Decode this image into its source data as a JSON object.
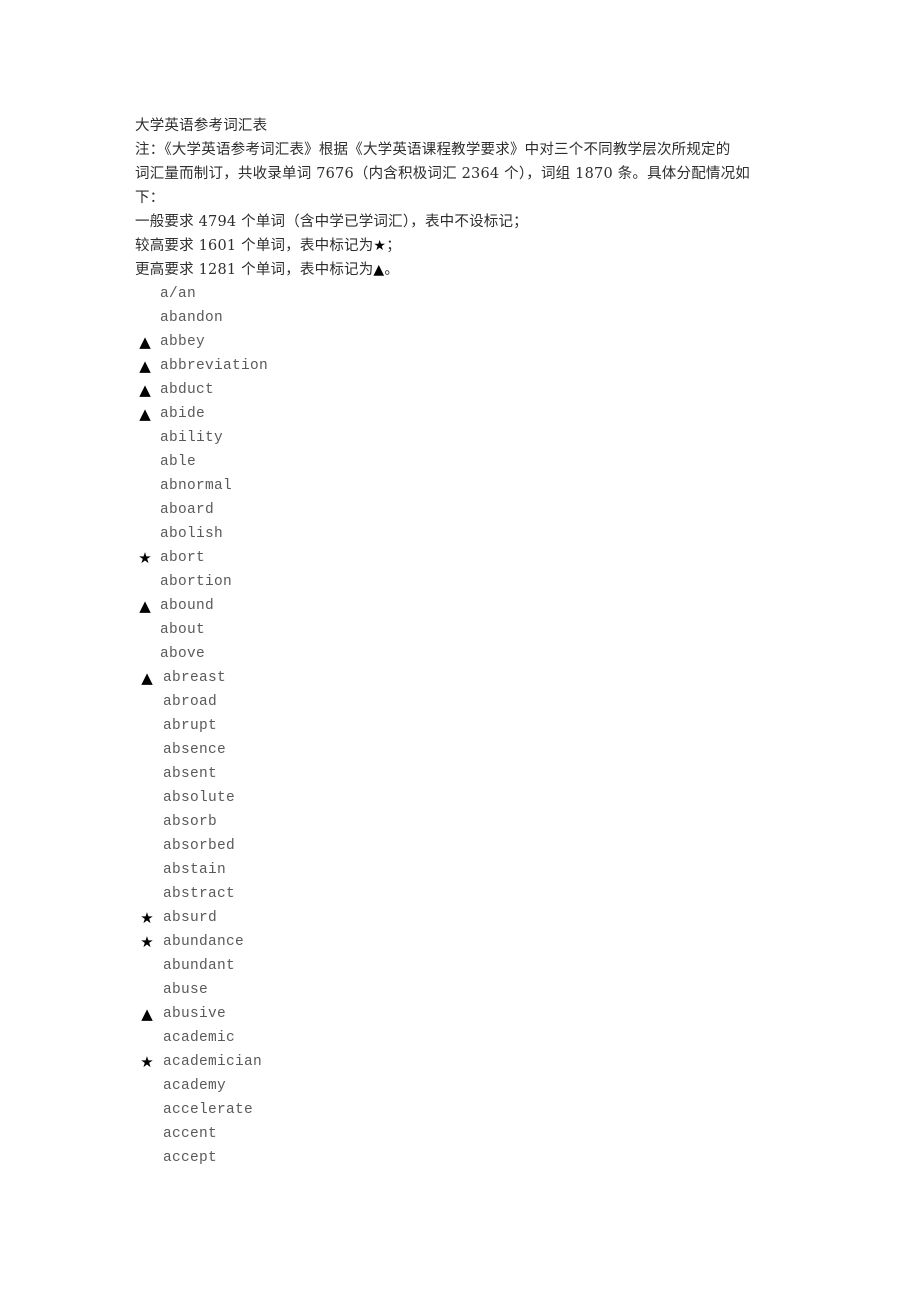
{
  "document": {
    "title": "大学英语参考词汇表",
    "intro_lines": [
      "注：《大学英语参考词汇表》根据《大学英语课程教学要求》中对三个不同教学层次所规定的",
      "词汇量而制订，共收录单词 7676（内含积极词汇 2364 个），词组 1870 条。具体分配情况如",
      "下："
    ],
    "levels": [
      {
        "text": "一般要求 4794 个单词（含中学已学词汇），表中不设标记；",
        "marker": ""
      },
      {
        "text": "较高要求 1601 个单词，表中标记为",
        "marker": "★",
        "suffix": "；"
      },
      {
        "text": "更高要求 1281 个单词，表中标记为",
        "marker": "▲",
        "suffix": "。"
      }
    ]
  },
  "markers": {
    "star": "★",
    "triangle": "▲",
    "star_meaning": "较高要求",
    "triangle_meaning": "更高要求"
  },
  "words": [
    {
      "marker": "",
      "word": "a/an"
    },
    {
      "marker": "",
      "word": "abandon"
    },
    {
      "marker": "▲",
      "word": "abbey"
    },
    {
      "marker": "▲",
      "word": "abbreviation"
    },
    {
      "marker": "▲",
      "word": "abduct"
    },
    {
      "marker": "▲",
      "word": "abide"
    },
    {
      "marker": "",
      "word": "ability"
    },
    {
      "marker": "",
      "word": "able"
    },
    {
      "marker": "",
      "word": "abnormal"
    },
    {
      "marker": "",
      "word": "aboard"
    },
    {
      "marker": "",
      "word": "abolish"
    },
    {
      "marker": "★",
      "word": "abort"
    },
    {
      "marker": "",
      "word": "abortion"
    },
    {
      "marker": "▲",
      "word": "abound"
    },
    {
      "marker": "",
      "word": "about"
    },
    {
      "marker": "",
      "word": "above"
    },
    {
      "marker": "▲",
      "word": "abreast"
    },
    {
      "marker": "",
      "word": "abroad"
    },
    {
      "marker": "",
      "word": "abrupt"
    },
    {
      "marker": "",
      "word": "absence"
    },
    {
      "marker": "",
      "word": "absent"
    },
    {
      "marker": "",
      "word": "absolute"
    },
    {
      "marker": "",
      "word": "absorb"
    },
    {
      "marker": "",
      "word": "absorbed"
    },
    {
      "marker": "",
      "word": "abstain"
    },
    {
      "marker": "",
      "word": "abstract"
    },
    {
      "marker": "★",
      "word": "absurd"
    },
    {
      "marker": "★",
      "word": "abundance"
    },
    {
      "marker": "",
      "word": "abundant"
    },
    {
      "marker": "",
      "word": "abuse"
    },
    {
      "marker": "▲",
      "word": "abusive"
    },
    {
      "marker": "",
      "word": "academic"
    },
    {
      "marker": "★",
      "word": "academician"
    },
    {
      "marker": "",
      "word": "academy"
    },
    {
      "marker": "",
      "word": "accelerate"
    },
    {
      "marker": "",
      "word": "accent"
    },
    {
      "marker": "",
      "word": "accept"
    }
  ]
}
